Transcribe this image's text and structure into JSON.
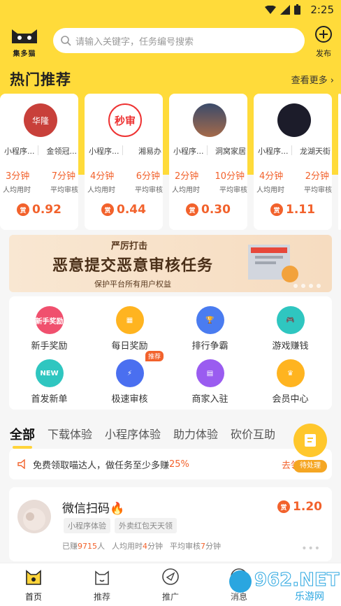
{
  "status_bar": {
    "time": "2:25"
  },
  "header": {
    "logo_label": "集多猫",
    "search_placeholder": "请输入关键字，任务编号搜索",
    "publish_label": "发布"
  },
  "hot": {
    "title": "热门推荐",
    "more": "查看更多",
    "cards": [
      {
        "tag_left": "小程序...",
        "tag_right": "金领冠...",
        "avg_time": "3分钟",
        "avg_review": "7分钟",
        "avg_time_label": "人均用时",
        "avg_review_label": "平均审核",
        "reward": "0.92",
        "avatar_text": "华隆"
      },
      {
        "tag_left": "小程序...",
        "tag_right": "湘易办",
        "avg_time": "4分钟",
        "avg_review": "6分钟",
        "avg_time_label": "人均用时",
        "avg_review_label": "平均审核",
        "reward": "0.44",
        "avatar_text": "秒审"
      },
      {
        "tag_left": "小程序...",
        "tag_right": "洞窝家居",
        "avg_time": "2分钟",
        "avg_review": "10分钟",
        "avg_time_label": "人均用时",
        "avg_review_label": "平均审核",
        "reward": "0.30",
        "avatar_text": ""
      },
      {
        "tag_left": "小程序...",
        "tag_right": "龙湖天街",
        "avg_time": "4分钟",
        "avg_review": "2分钟",
        "avg_time_label": "人均用时",
        "avg_review_label": "平均审核",
        "reward": "1.11",
        "avatar_text": ""
      }
    ],
    "reward_icon_text": "赏"
  },
  "banner": {
    "top": "严厉打击",
    "main": "恶意提交恶意审核任务",
    "sub": "保护平台所有用户权益"
  },
  "grid": [
    {
      "label": "新手奖励",
      "icon_text": "新手奖励",
      "color": "#f0506e"
    },
    {
      "label": "每日奖励",
      "icon_text": "",
      "color": "#ffb420"
    },
    {
      "label": "排行争霸",
      "icon_text": "",
      "color": "#4a7cf0"
    },
    {
      "label": "游戏赚钱",
      "icon_text": "",
      "color": "#2fc6c0"
    },
    {
      "label": "首发新单",
      "icon_text": "NEW",
      "color": "#2fc6c0"
    },
    {
      "label": "极速审核",
      "icon_text": "",
      "color": "#4a6ff0"
    },
    {
      "label": "商家入驻",
      "icon_text": "",
      "color": "#9a5cf0"
    },
    {
      "label": "会员中心",
      "icon_text": "",
      "color": "#ffb420"
    }
  ],
  "grid_badge": "推荐",
  "tabs": [
    "全部",
    "下载体验",
    "小程序体验",
    "助力体验",
    "砍价互助"
  ],
  "notice": {
    "text": "免费领取喵达人，做任务至少多赚",
    "highlight": "25%",
    "go": "去领"
  },
  "fab_label": "待处理",
  "task": {
    "title": "微信扫码",
    "tags": [
      "小程序体验",
      "外卖红包天天领"
    ],
    "earned_prefix": "已赚",
    "earned": "9715",
    "earned_suffix": "人",
    "avg_prefix": "人均用时",
    "avg": "4",
    "avg_suffix": "分钟",
    "review_prefix": "平均审核",
    "review": "7",
    "review_suffix": "分钟",
    "reward": "1.20"
  },
  "nav": [
    "首页",
    "推荐",
    "推广",
    "消息"
  ],
  "watermark": {
    "brand": "962.NET",
    "sub": "乐游网"
  }
}
